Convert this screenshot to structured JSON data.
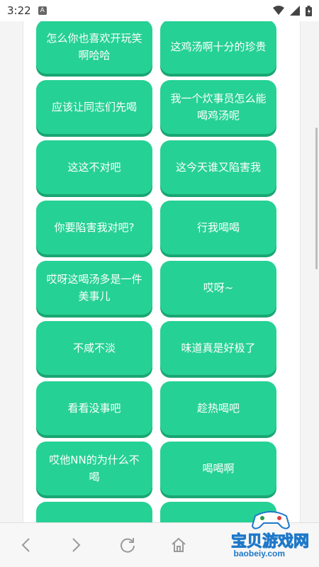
{
  "status": {
    "time": "3:22",
    "notification_icon": "A"
  },
  "tiles": [
    {
      "text": "怎么你也喜欢开玩笑啊哈哈"
    },
    {
      "text": "这鸡汤啊十分的珍贵"
    },
    {
      "text": "应该让同志们先喝"
    },
    {
      "text": "我一个炊事员怎么能喝鸡汤呢"
    },
    {
      "text": "这这不对吧"
    },
    {
      "text": "这今天谁又陷害我"
    },
    {
      "text": "你要陷害我对吧?"
    },
    {
      "text": "行我喝喝"
    },
    {
      "text": "哎呀这喝汤多是一件美事儿"
    },
    {
      "text": "哎呀~"
    },
    {
      "text": "不咸不淡"
    },
    {
      "text": "味道真是好极了"
    },
    {
      "text": "看看没事吧"
    },
    {
      "text": "趁热喝吧"
    },
    {
      "text": "哎他NN的为什么不喝"
    },
    {
      "text": "喝喝啊"
    },
    {
      "text": ""
    },
    {
      "text": ""
    }
  ],
  "colors": {
    "tile": "#26d195",
    "tile_shadow": "#1aa673"
  },
  "browser_nav": {
    "icons": [
      "back-icon",
      "forward-icon",
      "refresh-icon",
      "home-icon"
    ]
  },
  "watermark": {
    "title": "宝贝游戏网",
    "url": "baobeiy.com"
  }
}
